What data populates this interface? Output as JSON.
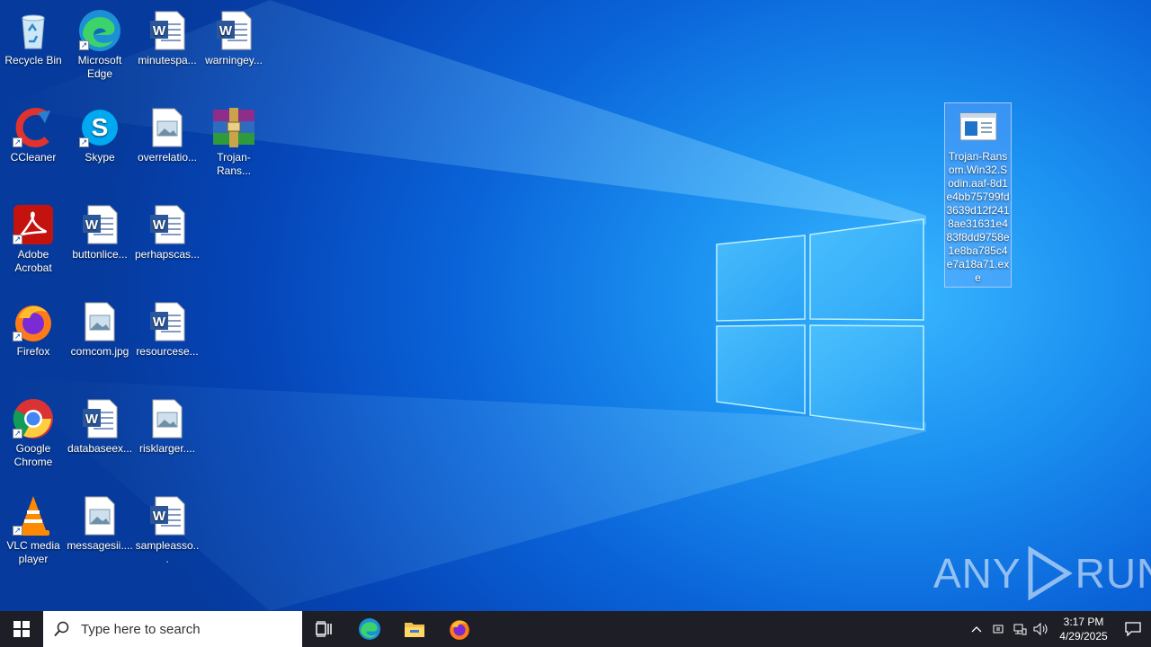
{
  "desktop": {
    "icons": [
      {
        "label": "Recycle Bin",
        "type": "recycle"
      },
      {
        "label": "Microsoft Edge",
        "type": "edge",
        "shortcut": true
      },
      {
        "label": "minutespa...",
        "type": "word"
      },
      {
        "label": "warningey...",
        "type": "word"
      },
      {
        "label": "CCleaner",
        "type": "ccleaner",
        "shortcut": true
      },
      {
        "label": "Skype",
        "type": "skype",
        "shortcut": true
      },
      {
        "label": "overrelatio...",
        "type": "image"
      },
      {
        "label": "Trojan-Rans...",
        "type": "winrar"
      },
      {
        "label": "Adobe Acrobat",
        "type": "acrobat",
        "shortcut": true
      },
      {
        "label": "buttonlice...",
        "type": "word"
      },
      {
        "label": "perhapscas...",
        "type": "word"
      },
      {
        "label": "Firefox",
        "type": "firefox",
        "shortcut": true
      },
      {
        "label": "comcom.jpg",
        "type": "image"
      },
      {
        "label": "resourcese...",
        "type": "word"
      },
      {
        "label": "Google Chrome",
        "type": "chrome",
        "shortcut": true
      },
      {
        "label": "databaseex...",
        "type": "word"
      },
      {
        "label": "risklarger....",
        "type": "image"
      },
      {
        "label": "VLC media player",
        "type": "vlc",
        "shortcut": true
      },
      {
        "label": "messagesii....",
        "type": "image"
      },
      {
        "label": "sampleasso...",
        "type": "word"
      }
    ],
    "selected_file": {
      "label": "Trojan-Ransom.Win32.Sodin.aaf-8d1e4bb75799fd3639d12f2418ae31631e483f8dd9758e1e8ba785c4e7a18a71.exe"
    }
  },
  "taskbar": {
    "search_placeholder": "Type here to search",
    "time": "3:17 PM",
    "date": "4/29/2025"
  },
  "watermark": {
    "left": "ANY",
    "right": "RUN"
  },
  "colors": {
    "taskbar": "#1e1f26",
    "wallpaper_accent": "#38b6ff",
    "selection": "#78aaff"
  }
}
